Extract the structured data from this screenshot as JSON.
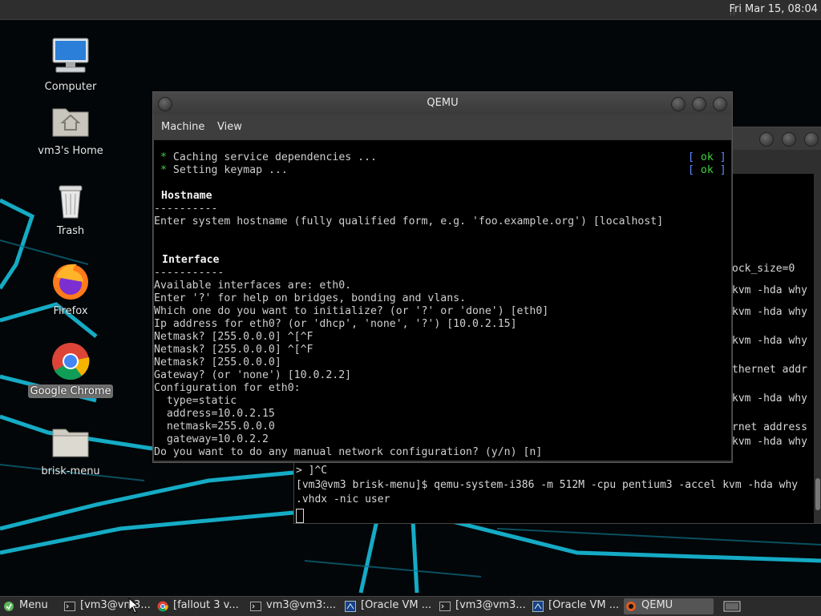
{
  "top_panel": {
    "clock": "Fri Mar 15, 08:04"
  },
  "desktop_icons": [
    {
      "label": "Computer",
      "icon": "computer-icon"
    },
    {
      "label": "vm3's Home",
      "icon": "home-folder-icon"
    },
    {
      "label": "Trash",
      "icon": "trash-icon"
    },
    {
      "label": "Firefox",
      "icon": "firefox-icon"
    },
    {
      "label": "Google Chrome",
      "icon": "chrome-icon",
      "selected": true
    },
    {
      "label": "brisk-menu",
      "icon": "folder-icon"
    }
  ],
  "qemu_window": {
    "title": "QEMU",
    "menu": [
      "Machine",
      "View"
    ],
    "screen_lines": {
      "l1": "Caching service dependencies ...",
      "l2": "Setting keymap ...",
      "ok": "ok",
      "hostname_heading": "Hostname",
      "hostname_rule": "----------",
      "hostname_prompt": "Enter system hostname (fully qualified form, e.g. 'foo.example.org') [localhost]",
      "interface_heading": "Interface",
      "interface_rule": "-----------",
      "i1": "Available interfaces are: eth0.",
      "i2": "Enter '?' for help on bridges, bonding and vlans.",
      "i3": "Which one do you want to initialize? (or '?' or 'done') [eth0]",
      "i4": "Ip address for eth0? (or 'dhcp', 'none', '?') [10.0.2.15]",
      "i5": "Netmask? [255.0.0.0] ^[^F",
      "i6": "Netmask? [255.0.0.0] ^[^F",
      "i7": "Netmask? [255.0.0.0]",
      "i8": "Gateway? (or 'none') [10.0.2.2]",
      "i9": "Configuration for eth0:",
      "i10": "  type=static",
      "i11": "  address=10.0.2.15",
      "i12": "  netmask=255.0.0.0",
      "i13": "  gateway=10.0.2.2",
      "i14": "Do you want to do any manual network configuration? (y/n) [n]"
    }
  },
  "terminal_window": {
    "right_fragments": {
      "r1": "ock_size=0",
      "r2": "kvm -hda why",
      "r3": "kvm -hda why",
      "r4": "kvm -hda why",
      "r5": "thernet addr",
      "r6": "kvm -hda why",
      "r7": "rnet address",
      "r8": "kvm -hda why"
    },
    "b1": "> ]^C",
    "b2": "[vm3@vm3 brisk-menu]$ qemu-system-i386 -m 512M -cpu pentium3 -accel kvm -hda why",
    "b3": ".vhdx -nic user"
  },
  "taskbar": {
    "menu_label": "Menu",
    "tasks": [
      {
        "label": "[vm3@vm3...",
        "icon": "terminal-icon"
      },
      {
        "label": "[fallout 3 v...",
        "icon": "chrome-icon"
      },
      {
        "label": "vm3@vm3:...",
        "icon": "terminal-icon"
      },
      {
        "label": "[Oracle VM ...",
        "icon": "virtualbox-icon"
      },
      {
        "label": "[vm3@vm3...",
        "icon": "terminal-icon"
      },
      {
        "label": "[Oracle VM ...",
        "icon": "virtualbox-icon"
      },
      {
        "label": "QEMU",
        "icon": "qemu-icon",
        "active": true
      }
    ]
  },
  "colors": {
    "neon_accent": "#19c8e6",
    "terminal_ok": "#3fd23f",
    "terminal_bracket": "#5a8cff"
  }
}
